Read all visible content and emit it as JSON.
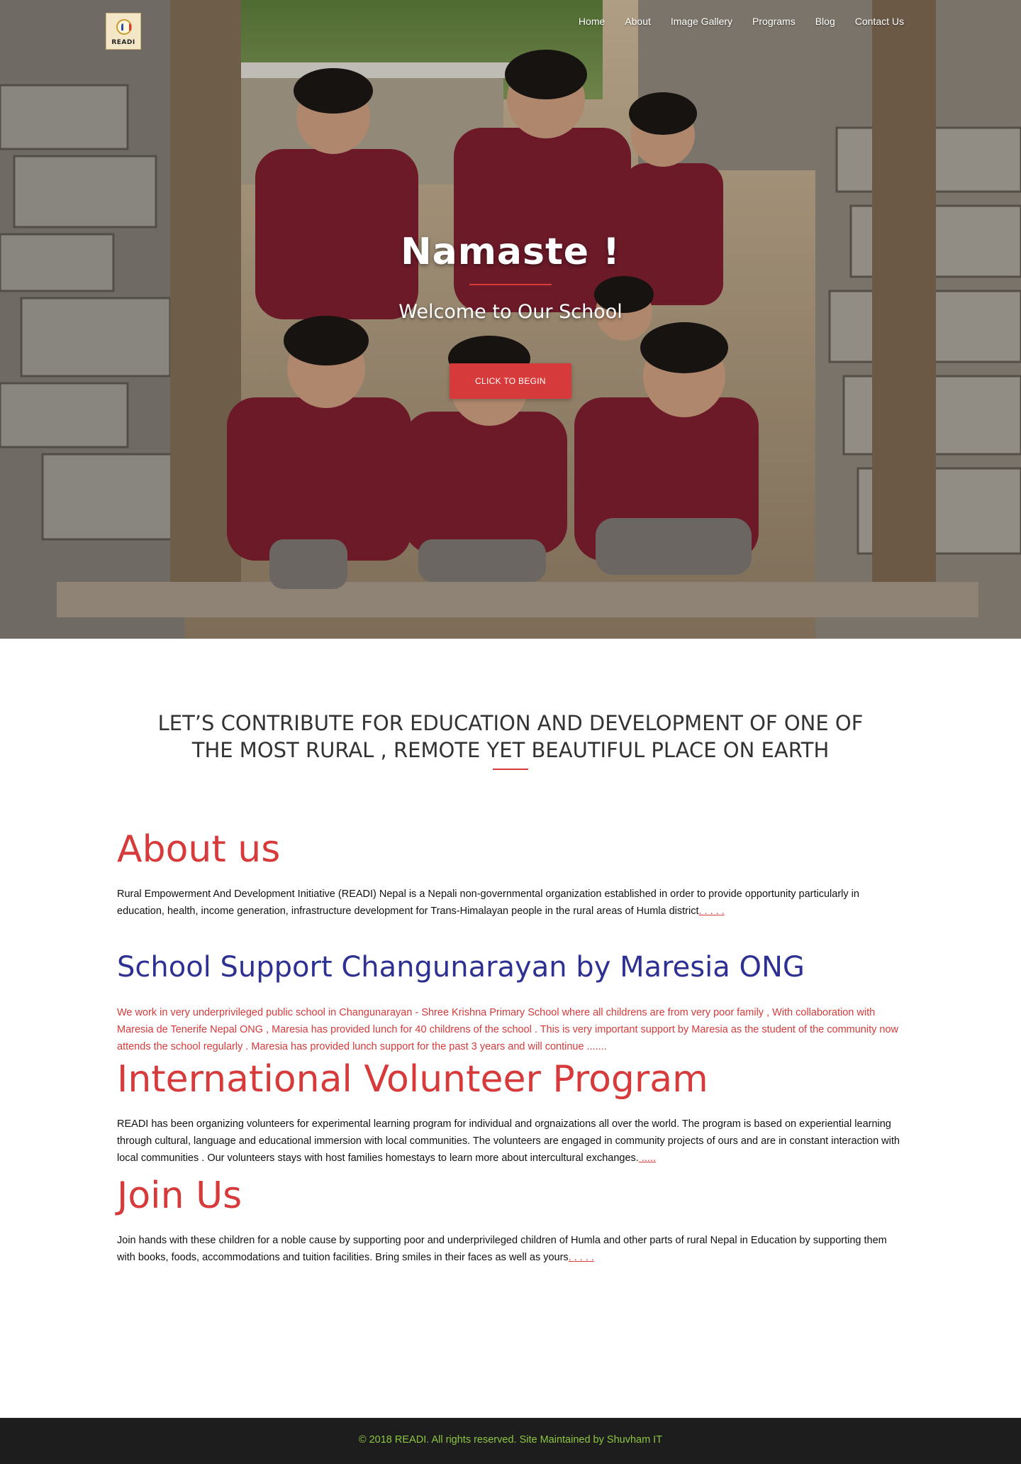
{
  "nav": {
    "logo_text": "READI",
    "items": [
      "Home",
      "About",
      "Image Gallery",
      "Programs",
      "Blog",
      "Contact Us"
    ]
  },
  "hero": {
    "title": "Namaste !",
    "subtitle": "Welcome to Our School",
    "button": "CLICK TO BEGIN"
  },
  "tagline": {
    "line1": "LET’S CONTRIBUTE FOR EDUCATION AND DEVELOPMENT OF ONE OF",
    "line2": "THE MOST RURAL , REMOTE YET BEAUTIFUL PLACE ON EARTH"
  },
  "sections": {
    "about": {
      "title": "About us",
      "text": "Rural Empowerment And Development Initiative (READI) Nepal is a Nepali non-governmental organization established in order to provide opportunity particularly in education, health, income generation, infrastructure development for Trans-Himalayan people in the rural areas of Humla district",
      "more": ". . . . ."
    },
    "school": {
      "title": "School Support Changunarayan by Maresia ONG",
      "text": "We work in very underprivileged public school in Changunarayan - Shree Krishna Primary School  where all childrens are from very poor family , With collaboration with Maresia de Tenerife Nepal ONG , Maresia has provided lunch for 40 childrens of the school . This is very important support by Maresia as the student of the community now attends the school regularly . Maresia has provided lunch support for the past 3 years and will continue .......",
      "more": ""
    },
    "volunteer": {
      "title": "International Volunteer Program",
      "text": "READI has been organizing volunteers for experimental learning program for individual and orgnaizations  all over the world. The program is based on experiential learning through cultural, language and educational immersion with local communities. The volunteers are engaged in community projects of ours and are in constant interaction with local communities . Our volunteers stays with host families homestays to learn more about intercultural exchanges.",
      "more": " ....."
    },
    "join": {
      "title": "Join Us",
      "text": "Join hands with these children for a noble cause by supporting poor and underprivileged children of Humla and other parts of rural Nepal in Education by supporting them with books, foods, accommodations and tuition facilities. Bring smiles in their faces as well as yours",
      "more": ". . . . ."
    }
  },
  "footer": {
    "text": "© 2018 READI. All rights reserved. Site Maintained by Shuvham IT"
  },
  "colors": {
    "accent_red": "#d63a3a",
    "heading_blue": "#2e3192",
    "footer_bg": "#1d1d1d",
    "footer_text": "#8cc63f"
  }
}
